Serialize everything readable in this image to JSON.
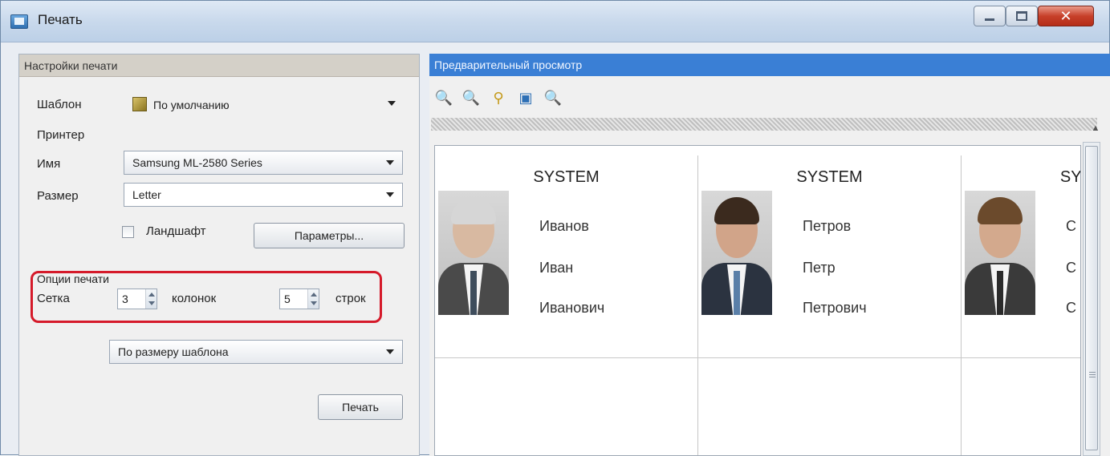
{
  "window": {
    "title": "Печать"
  },
  "left": {
    "header": "Настройки печати",
    "template_label": "Шаблон",
    "template_value": "По умолчанию",
    "printer_label": "Принтер",
    "name_label": "Имя",
    "name_value": "Samsung ML-2580 Series",
    "size_label": "Размер",
    "size_value": "Letter",
    "landscape_label": "Ландшафт",
    "landscape_checked": false,
    "params_button": "Параметры...",
    "print_options_label": "Опции печати",
    "grid_label": "Сетка",
    "columns_value": "3",
    "columns_label": "колонок",
    "rows_value": "5",
    "rows_label": "строк",
    "scale_value": "По размеру шаблона",
    "print_button": "Печать"
  },
  "right": {
    "header": "Предварительный просмотр",
    "toolbar_icons": [
      "zoom-in-icon",
      "zoom-out-icon",
      "zoom-page-icon",
      "fit-icon",
      "zoom-custom-icon"
    ],
    "cards": [
      {
        "title": "SYSTEM",
        "last": "Иванов",
        "first": "Иван",
        "middle": "Иванович"
      },
      {
        "title": "SYSTEM",
        "last": "Петров",
        "first": "Петр",
        "middle": "Петрович"
      },
      {
        "title": "SYSTEM",
        "last": "С",
        "first": "С",
        "middle": "С"
      }
    ]
  },
  "colors": {
    "accent": "#3a7fd5",
    "highlight": "#d51a2a"
  }
}
